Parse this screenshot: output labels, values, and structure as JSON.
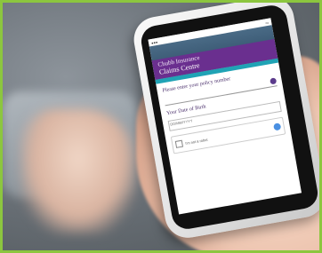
{
  "scene": {
    "border_color": "#8cc63f",
    "accent_purple": "#6a2f8f",
    "accent_teal": "#20a3b5"
  },
  "phone_screen": {
    "header_line1": "Chubb Insurance",
    "header_line2": "Claims Centre",
    "label_policy": "Please enter your policy number",
    "label_dob": "Your Date of Birth",
    "date_placeholder": "DD/MM/YYYY",
    "captcha_text": "I'm not a robot"
  }
}
